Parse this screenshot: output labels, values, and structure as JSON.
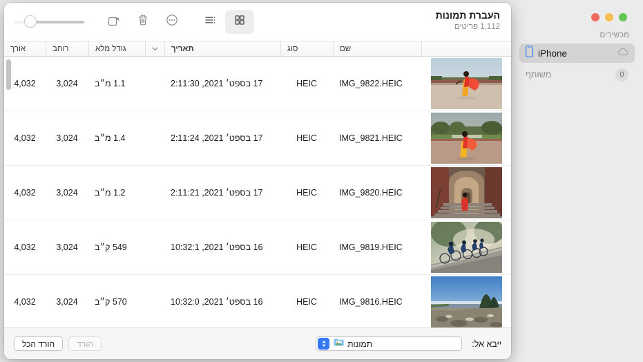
{
  "window": {
    "traffic_lights": [
      "green",
      "yellow",
      "red"
    ]
  },
  "sidebar": {
    "devices_header": "מכשירים",
    "items": [
      {
        "label": "iPhone",
        "icon": "iphone-icon",
        "accessory_icon": "cloud-icon",
        "selected": true
      },
      {
        "label": "משותף",
        "icon": "",
        "badge": "0",
        "selected": false
      }
    ]
  },
  "toolbar": {
    "title": "העברת תמונות",
    "subtitle": "1,112 פריטים",
    "zoom_slider_value": 18,
    "buttons": [
      {
        "name": "rotate-button",
        "icon": "rotate-icon"
      },
      {
        "name": "delete-button",
        "icon": "trash-icon"
      },
      {
        "name": "more-options-button",
        "icon": "ellipsis-circle-icon"
      },
      {
        "name": "list-view-button",
        "icon": "list-view-icon"
      },
      {
        "name": "grid-view-button",
        "icon": "grid-view-icon",
        "selected": true
      }
    ]
  },
  "table": {
    "columns": [
      {
        "key": "thumb",
        "label": ""
      },
      {
        "key": "name",
        "label": "שם"
      },
      {
        "key": "type",
        "label": "סוג"
      },
      {
        "key": "date",
        "label": "תאריך",
        "sorted": true
      },
      {
        "key": "sort",
        "label": ""
      },
      {
        "key": "size",
        "label": "גודל מלא"
      },
      {
        "key": "width",
        "label": "רוחב"
      },
      {
        "key": "length",
        "label": "אורך"
      }
    ],
    "rows": [
      {
        "name": "IMG_9822.HEIC",
        "type": "HEIC",
        "date": "17 בספט׳ 2021, 2:11:30",
        "size": "1.1 מ״ב",
        "width": "3,024",
        "length": "4,032",
        "thumb": "sari-wall"
      },
      {
        "name": "IMG_9821.HEIC",
        "type": "HEIC",
        "date": "17 בספט׳ 2021, 2:11:24",
        "size": "1.4 מ״ב",
        "width": "3,024",
        "length": "4,032",
        "thumb": "sari-garden"
      },
      {
        "name": "IMG_9820.HEIC",
        "type": "HEIC",
        "date": "17 בספט׳ 2021, 2:11:21",
        "size": "1.2 מ״ב",
        "width": "3,024",
        "length": "4,032",
        "thumb": "sari-stairs"
      },
      {
        "name": "IMG_9819.HEIC",
        "type": "HEIC",
        "date": "16 בספט׳ 2021, 10:32:1",
        "size": "549 ק״ב",
        "width": "3,024",
        "length": "4,032",
        "thumb": "cyclists"
      },
      {
        "name": "IMG_9816.HEIC",
        "type": "HEIC",
        "date": "16 בספט׳ 2021, 10:32:0",
        "size": "570 ק״ב",
        "width": "3,024",
        "length": "4,032",
        "thumb": "mountain"
      }
    ]
  },
  "bottom_bar": {
    "import_to_label": "ייבא אל:",
    "destination": "תמונות",
    "destination_icon": "photos-folder-icon",
    "download_all_label": "הורד הכל",
    "download_label": "הורד",
    "download_disabled": true
  },
  "colors": {
    "accent": "#3478f6",
    "selected_row": "#d4d4d4",
    "window_bg": "#ebebeb"
  }
}
